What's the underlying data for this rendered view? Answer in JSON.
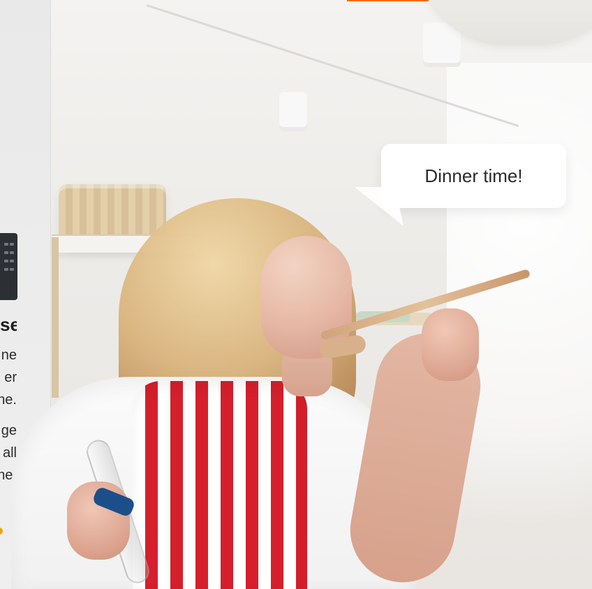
{
  "speech_bubble": {
    "text": "Dinner time!"
  },
  "left_panel": {
    "cut_heading": "se",
    "lines": [
      "ne",
      "er",
      "ne.",
      "ge",
      "all",
      "ne."
    ]
  }
}
